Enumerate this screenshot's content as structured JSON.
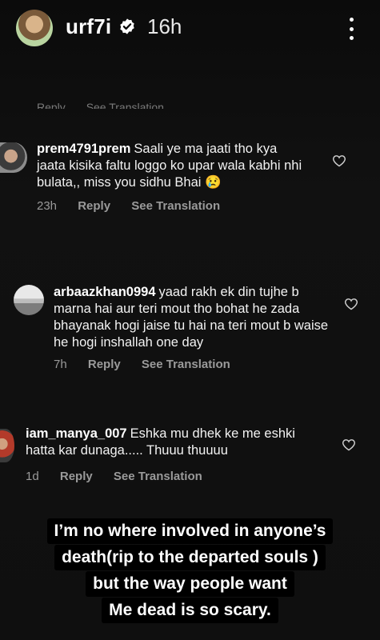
{
  "header": {
    "username": "urf7i",
    "time_ago": "16h",
    "avatar_icon": "profile-avatar",
    "verified_icon": "verified-badge-icon",
    "more_icon": "more-vertical-icon"
  },
  "comments": [
    {
      "username": "prem4791prem",
      "text": "Saali ye ma jaati tho kya jaata kisika faltu loggo ko upar wala kabhi nhi bulata,, miss you sidhu Bhai 😢",
      "time": "23h",
      "reply_label": "Reply",
      "translate_label": "See Translation",
      "like_icon": "heart-outline-icon"
    },
    {
      "username": "arbaazkhan0994",
      "text": "yaad rakh ek din tujhe b marna hai aur teri mout tho bohat he zada bhayanak hogi jaise tu hai na teri mout b waise he hogi inshallah one day",
      "time": "7h",
      "reply_label": "Reply",
      "translate_label": "See Translation",
      "like_icon": "heart-outline-icon"
    },
    {
      "username": "iam_manya_007",
      "text": "Eshka mu dhek ke me eshki hatta kar dunaga..... Thuuu thuuuu",
      "time": "1d",
      "reply_label": "Reply",
      "translate_label": "See Translation",
      "like_icon": "heart-outline-icon"
    }
  ],
  "caption": {
    "lines": [
      "I’m no where involved in anyone’s",
      "death(rip to the departed souls )",
      "but the way people want",
      "Me dead is so scary."
    ]
  },
  "colors": {
    "background": "#0f0f0f",
    "text": "#ffffff",
    "meta": "#9a9a9a",
    "caption_bg": "#000000"
  }
}
